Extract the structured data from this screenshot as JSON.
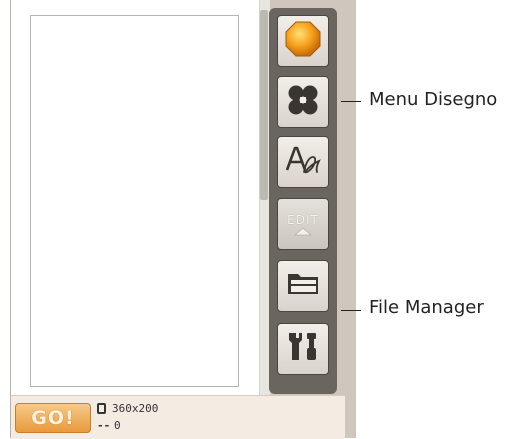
{
  "toolbar": {
    "buttons": [
      {
        "name": "start-button",
        "icon": "orange-octagon-icon"
      },
      {
        "name": "design-menu-button",
        "icon": "four-petal-icon"
      },
      {
        "name": "text-button",
        "icon": "letter-a-script-icon"
      },
      {
        "name": "edit-button",
        "icon": "edit-arrow-icon",
        "label": "EDIT",
        "disabled": true
      },
      {
        "name": "file-manager-button",
        "icon": "folder-icon"
      },
      {
        "name": "settings-button",
        "icon": "tools-icon"
      }
    ]
  },
  "statusbar": {
    "go_label": "GO!",
    "hoop_size": "360x200",
    "stitch_count_prefix": "--",
    "stitch_count": "0"
  },
  "callouts": {
    "design_menu": "Menu Disegno",
    "file_manager": "File Manager"
  },
  "colors": {
    "go_button": "#e99a3c",
    "start_icon": "#f0a020",
    "toolbar_bg": "#6b655f"
  }
}
